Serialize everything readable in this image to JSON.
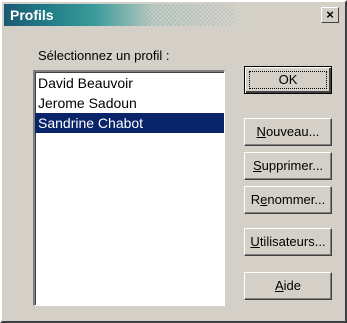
{
  "window": {
    "title": "Profils",
    "close_label": "×"
  },
  "prompt": "Sélectionnez un profil :",
  "profiles": [
    {
      "label": "David Beauvoir",
      "selected": false
    },
    {
      "label": "Jerome Sadoun",
      "selected": false
    },
    {
      "label": "Sandrine Chabot",
      "selected": true
    }
  ],
  "buttons": {
    "ok": {
      "label": "OK"
    },
    "nouveau": {
      "mnemonic": "N",
      "rest": "ouveau..."
    },
    "supprimer": {
      "mnemonic": "S",
      "rest": "upprimer..."
    },
    "renommer": {
      "pre": "R",
      "mnemonic": "e",
      "rest": "nommer..."
    },
    "utilisateurs": {
      "mnemonic": "U",
      "rest": "tilisateurs..."
    },
    "aide": {
      "mnemonic": "A",
      "rest": "ide"
    }
  },
  "colors": {
    "face": "#d4d0c8",
    "selection": "#0a246a",
    "title_start": "#1a5a73"
  }
}
